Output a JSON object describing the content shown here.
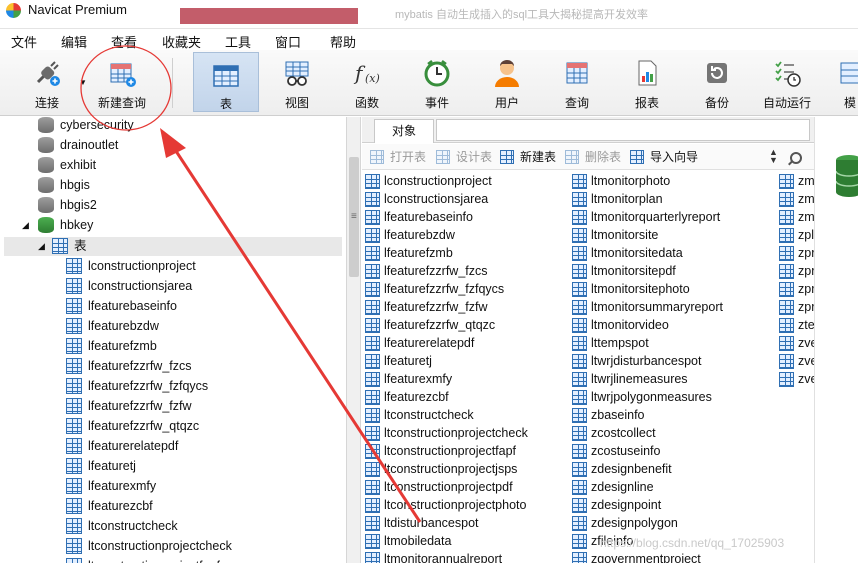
{
  "window": {
    "title": "Navicat Premium",
    "blurred_title": "mybatis 自动生成插入的sql工具大揭秘提高开发效率"
  },
  "menu": [
    "文件",
    "编辑",
    "查看",
    "收藏夹",
    "工具",
    "窗口",
    "帮助"
  ],
  "toolbar": [
    {
      "label": "连接",
      "icon": "plug-icon"
    },
    {
      "label": "新建查询",
      "icon": "new-query-icon"
    },
    {
      "label": "表",
      "icon": "table-icon"
    },
    {
      "label": "视图",
      "icon": "view-icon"
    },
    {
      "label": "函数",
      "icon": "function-icon"
    },
    {
      "label": "事件",
      "icon": "event-clock-icon"
    },
    {
      "label": "用户",
      "icon": "user-icon"
    },
    {
      "label": "查询",
      "icon": "query-icon"
    },
    {
      "label": "报表",
      "icon": "report-icon"
    },
    {
      "label": "备份",
      "icon": "backup-icon"
    },
    {
      "label": "自动运行",
      "icon": "autorun-icon"
    },
    {
      "label": "模",
      "icon": "model-icon"
    }
  ],
  "tree": {
    "databases": [
      "cybersecurity",
      "drainoutlet",
      "exhibit",
      "hbgis",
      "hbgis2",
      "hbkey"
    ],
    "tables_group": "表",
    "tables": [
      "lconstructionproject",
      "lconstructionsjarea",
      "lfeaturebaseinfo",
      "lfeaturebzdw",
      "lfeaturefzmb",
      "lfeaturefzzrfw_fzcs",
      "lfeaturefzzrfw_fzfqycs",
      "lfeaturefzzrfw_fzfw",
      "lfeaturefzzrfw_qtqzc",
      "lfeaturerelatepdf",
      "lfeaturetj",
      "lfeaturexmfy",
      "lfeaturezcbf",
      "ltconstructcheck",
      "ltconstructionprojectcheck",
      "ltconstructionprojectfapf"
    ]
  },
  "objects_tab": "对象",
  "object_toolbar": [
    {
      "label": "打开表",
      "enabled": false
    },
    {
      "label": "设计表",
      "enabled": false
    },
    {
      "label": "新建表",
      "enabled": true
    },
    {
      "label": "删除表",
      "enabled": false
    },
    {
      "label": "导入向导",
      "enabled": true
    }
  ],
  "objects": {
    "col1": [
      "lconstructionproject",
      "lconstructionsjarea",
      "lfeaturebaseinfo",
      "lfeaturebzdw",
      "lfeaturefzmb",
      "lfeaturefzzrfw_fzcs",
      "lfeaturefzzrfw_fzfqycs",
      "lfeaturefzzrfw_fzfw",
      "lfeaturefzzrfw_qtqzc",
      "lfeaturerelatepdf",
      "lfeaturetj",
      "lfeaturexmfy",
      "lfeaturezcbf",
      "ltconstructcheck",
      "ltconstructionprojectcheck",
      "ltconstructionprojectfapf",
      "ltconstructionprojectjsps",
      "ltconstructionprojectpdf",
      "ltconstructionprojectphoto",
      "ltdisturbancespot",
      "ltmobiledata",
      "ltmonitorannualreport"
    ],
    "col2": [
      "ltmonitorphoto",
      "ltmonitorplan",
      "ltmonitorquarterlyreport",
      "ltmonitorsite",
      "ltmonitorsitedata",
      "ltmonitorsitepdf",
      "ltmonitorsitephoto",
      "ltmonitorsummaryreport",
      "ltmonitorvideo",
      "lttempspot",
      "ltwrjdisturbancespot",
      "ltwrjlinemeasures",
      "ltwrjpolygonmeasures",
      "zbaseinfo",
      "zcostcollect",
      "zcostuseinfo",
      "zdesignbenefit",
      "zdesignline",
      "zdesignpoint",
      "zdesignpolygon",
      "zfileinfo",
      "zgovernmentproject"
    ],
    "col3": [
      "zm",
      "zm",
      "zm",
      "zpl",
      "zpr",
      "zpr",
      "zpr",
      "zpr",
      "zte",
      "zve",
      "zve",
      "zve"
    ]
  },
  "watermark": "https://blog.csdn.net/qq_17025903",
  "colors": {
    "annotation": "#e53935",
    "selected_tool": "#c6d7ec",
    "table_icon": "#2f6fb3",
    "db_green": "#2e7d32"
  }
}
